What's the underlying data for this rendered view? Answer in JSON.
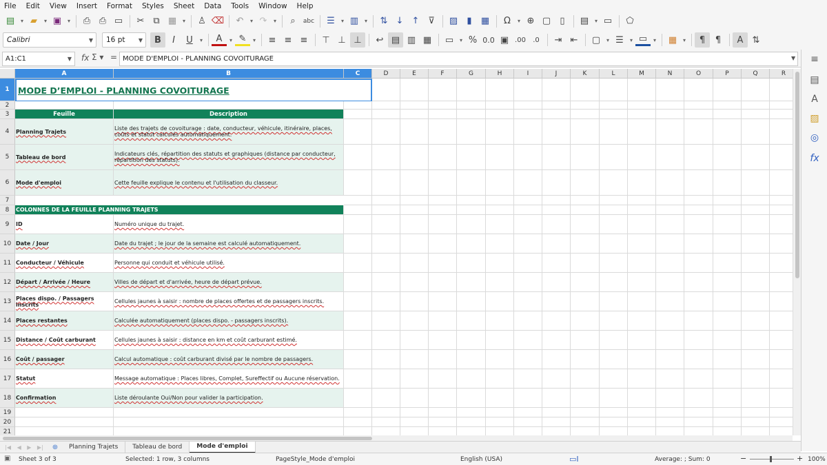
{
  "menu": [
    "File",
    "Edit",
    "View",
    "Insert",
    "Format",
    "Styles",
    "Sheet",
    "Data",
    "Tools",
    "Window",
    "Help"
  ],
  "toolbar": {
    "font_name": "Calibri",
    "font_size": "16 pt"
  },
  "formula": {
    "name_box": "A1:C1",
    "content": "MODE D'EMPLOI - PLANNING COVOITURAGE"
  },
  "columns": [
    "A",
    "B",
    "C",
    "D",
    "E",
    "F",
    "G",
    "H",
    "I",
    "J",
    "K",
    "L",
    "M",
    "N",
    "O",
    "P",
    "Q",
    "R"
  ],
  "sheet": {
    "title": "MODE D’EMPLOI - PLANNING COVOITURAGE",
    "header": {
      "a": "Feuille",
      "b": "Description"
    },
    "sheets_table": [
      {
        "name": "Planning Trajets",
        "desc": "Liste des trajets de covoiturage : date, conducteur, véhicule, itinéraire, places, coûts et statut calculés automatiquement."
      },
      {
        "name": "Tableau de bord",
        "desc": "Indicateurs clés, répartition des statuts et graphiques (distance par conducteur, répartition des statuts)."
      },
      {
        "name": "Mode d'emploi",
        "desc": "Cette feuille explique le contenu et l'utilisation du classeur."
      }
    ],
    "section": "COLONNES DE LA FEUILLE PLANNING TRAJETS",
    "columns_table": [
      {
        "name": "ID",
        "desc": "Numéro unique du trajet."
      },
      {
        "name": "Date / Jour",
        "desc": "Date du trajet ; le jour de la semaine est calculé automatiquement."
      },
      {
        "name": "Conducteur / Véhicule",
        "desc": "Personne qui conduit et véhicule utilisé."
      },
      {
        "name": "Départ / Arrivée / Heure",
        "desc": "Villes de départ et d'arrivée, heure de départ prévue."
      },
      {
        "name": "Places dispo. / Passagers inscrits",
        "desc": "Cellules jaunes à saisir : nombre de places offertes et de passagers inscrits."
      },
      {
        "name": "Places restantes",
        "desc": "Calculée automatiquement (places dispo. - passagers inscrits)."
      },
      {
        "name": "Distance / Coût carburant",
        "desc": "Cellules jaunes à saisir : distance en km et coût carburant estimé."
      },
      {
        "name": "Coût / passager",
        "desc": "Calcul automatique : coût carburant divisé par le nombre de passagers."
      },
      {
        "name": "Statut",
        "desc": "Message automatique : Places libres, Complet, Sureffectif ou Aucune réservation."
      },
      {
        "name": "Confirmation",
        "desc": "Liste déroulante Oui/Non pour valider la participation."
      }
    ]
  },
  "tabs": [
    "Planning Trajets",
    "Tableau de bord",
    "Mode d'emploi"
  ],
  "active_tab": 2,
  "status": {
    "sheet": "Sheet 3 of 3",
    "selected": "Selected: 1 row, 3 columns",
    "page_style": "PageStyle_Mode d'emploi",
    "language": "English (USA)",
    "sum": "Average: ; Sum: 0",
    "zoom": "100%"
  },
  "colors": {
    "accent": "#11825a",
    "alt_row": "#e6f3ee",
    "selection": "#3c8ce0"
  }
}
